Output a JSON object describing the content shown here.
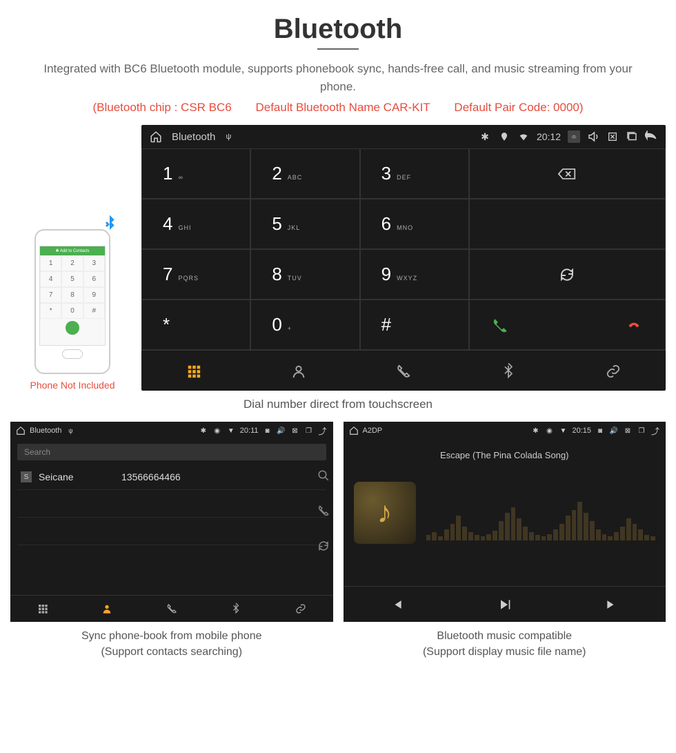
{
  "page": {
    "title": "Bluetooth",
    "description": "Integrated with BC6 Bluetooth module, supports phonebook sync, hands-free call, and music streaming from your phone.",
    "spec_chip": "(Bluetooth chip : CSR BC6",
    "spec_name": "Default Bluetooth Name CAR-KIT",
    "spec_code": "Default Pair Code: 0000)"
  },
  "phone": {
    "top_label": "Add to Contacts",
    "caption": "Phone Not Included",
    "keys": [
      "1",
      "2",
      "3",
      "4",
      "5",
      "6",
      "7",
      "8",
      "9",
      "*",
      "0",
      "#"
    ]
  },
  "dialer": {
    "statusbar": {
      "title": "Bluetooth",
      "time": "20:12"
    },
    "keys": [
      {
        "num": "1",
        "ltr": "∞"
      },
      {
        "num": "2",
        "ltr": "ABC"
      },
      {
        "num": "3",
        "ltr": "DEF"
      },
      {
        "num": "4",
        "ltr": "GHI"
      },
      {
        "num": "5",
        "ltr": "JKL"
      },
      {
        "num": "6",
        "ltr": "MNO"
      },
      {
        "num": "7",
        "ltr": "PQRS"
      },
      {
        "num": "8",
        "ltr": "TUV"
      },
      {
        "num": "9",
        "ltr": "WXYZ"
      },
      {
        "num": "*",
        "ltr": ""
      },
      {
        "num": "0",
        "ltr": "+"
      },
      {
        "num": "#",
        "ltr": ""
      }
    ],
    "caption": "Dial number direct from touchscreen"
  },
  "contacts": {
    "statusbar": {
      "title": "Bluetooth",
      "time": "20:11"
    },
    "search_placeholder": "Search",
    "item": {
      "badge": "S",
      "name": "Seicane",
      "number": "13566664466"
    },
    "caption_l1": "Sync phone-book from mobile phone",
    "caption_l2": "(Support contacts searching)"
  },
  "music": {
    "statusbar": {
      "title": "A2DP",
      "time": "20:15"
    },
    "song": "Escape (The Pina Colada Song)",
    "caption_l1": "Bluetooth music compatible",
    "caption_l2": "(Support display music file name)"
  }
}
